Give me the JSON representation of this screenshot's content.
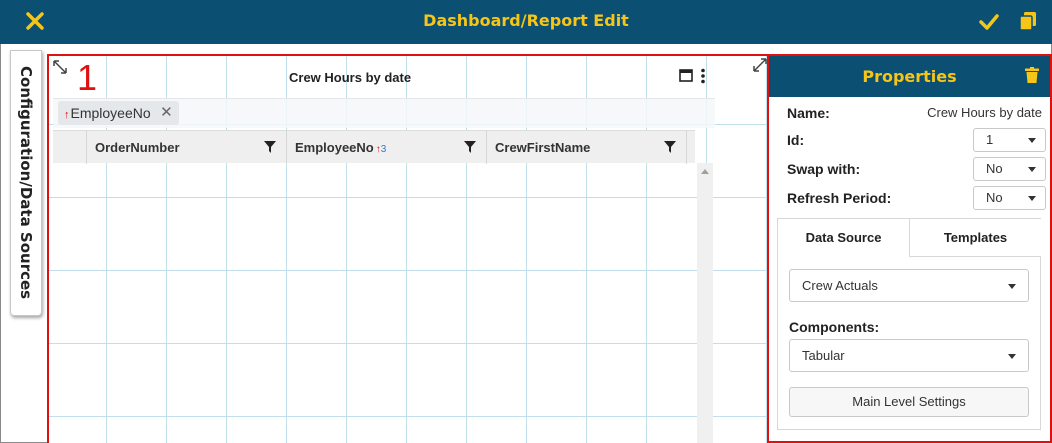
{
  "titlebar": {
    "title": "Dashboard/Report Edit",
    "close_icon": "close-icon",
    "save_icon": "check-icon",
    "copy_icon": "copy-icon"
  },
  "sidetab": {
    "label": "Configuration/Data Sources"
  },
  "widget": {
    "number": "1",
    "title": "Crew Hours by date",
    "group_chip": {
      "label": "EmployeeNo",
      "sort_icon": "sort-ascending-icon"
    },
    "columns": [
      {
        "label": "OrderNumber"
      },
      {
        "label": "EmployeeNo",
        "sort_index": "3"
      },
      {
        "label": "CrewFirstName"
      }
    ]
  },
  "properties": {
    "title": "Properties",
    "name_label": "Name:",
    "name_value": "Crew Hours by date",
    "id_label": "Id:",
    "id_value": "1",
    "swap_label": "Swap with:",
    "swap_value": "No",
    "refresh_label": "Refresh Period:",
    "refresh_value": "No",
    "tabs": {
      "data_source": "Data Source",
      "templates": "Templates"
    },
    "data_source_value": "Crew Actuals",
    "components_label": "Components:",
    "components_value": "Tabular",
    "main_level_button": "Main Level Settings"
  },
  "colors": {
    "header_bg": "#0b4f73",
    "accent_yellow": "#f5c518",
    "selection_red": "#e01010",
    "grid_line": "#bfe0ea"
  }
}
